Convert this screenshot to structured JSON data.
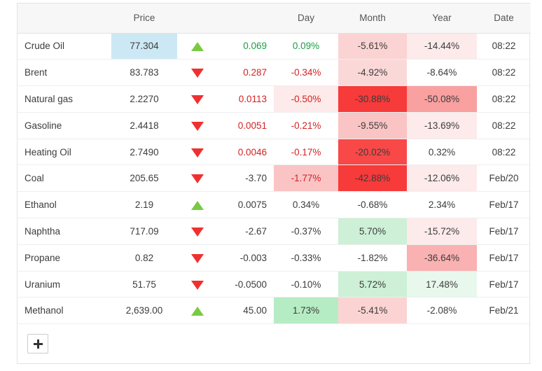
{
  "table": {
    "columns": [
      {
        "key": "name",
        "label": ""
      },
      {
        "key": "price",
        "label": "Price"
      },
      {
        "key": "arrow",
        "label": ""
      },
      {
        "key": "chg",
        "label": ""
      },
      {
        "key": "day",
        "label": "Day"
      },
      {
        "key": "month",
        "label": "Month"
      },
      {
        "key": "year",
        "label": "Year"
      },
      {
        "key": "date",
        "label": "Date"
      }
    ],
    "rows": [
      {
        "name": "Crude Oil",
        "price": "77.304",
        "price_hl": "#cce8f4",
        "dir": "up",
        "change": "0.069",
        "change_dir": "up",
        "day": "0.09%",
        "day_dir": "up",
        "day_bg": "",
        "month": "-5.61%",
        "month_bg": "#fbd3d3",
        "year": "-14.44%",
        "year_bg": "#fdeaea",
        "date": "08:22"
      },
      {
        "name": "Brent",
        "price": "83.783",
        "price_hl": "",
        "dir": "down",
        "change": "0.287",
        "change_dir": "down",
        "day": "-0.34%",
        "day_dir": "down",
        "day_bg": "",
        "month": "-4.92%",
        "month_bg": "#fbd8d8",
        "year": "-8.64%",
        "year_bg": "",
        "date": "08:22"
      },
      {
        "name": "Natural gas",
        "price": "2.2270",
        "price_hl": "",
        "dir": "down",
        "change": "0.0113",
        "change_dir": "down",
        "day": "-0.50%",
        "day_dir": "down",
        "day_bg": "#fdeaea",
        "month": "-30.88%",
        "month_bg": "#f73a3a",
        "year": "-50.08%",
        "year_bg": "#f9a0a0",
        "date": "08:22"
      },
      {
        "name": "Gasoline",
        "price": "2.4418",
        "price_hl": "",
        "dir": "down",
        "change": "0.0051",
        "change_dir": "down",
        "day": "-0.21%",
        "day_dir": "down",
        "day_bg": "",
        "month": "-9.55%",
        "month_bg": "#fac4c4",
        "year": "-13.69%",
        "year_bg": "#fdeaea",
        "date": "08:22"
      },
      {
        "name": "Heating Oil",
        "price": "2.7490",
        "price_hl": "",
        "dir": "down",
        "change": "0.0046",
        "change_dir": "down",
        "day": "-0.17%",
        "day_dir": "down",
        "day_bg": "",
        "month": "-20.02%",
        "month_bg": "#f94848",
        "year": "0.32%",
        "year_bg": "",
        "date": "08:22"
      },
      {
        "name": "Coal",
        "price": "205.65",
        "price_hl": "",
        "dir": "down",
        "change": "-3.70",
        "change_dir": "neutral",
        "day": "-1.77%",
        "day_dir": "down",
        "day_bg": "#fac4c4",
        "month": "-42.88%",
        "month_bg": "#f73a3a",
        "year": "-12.06%",
        "year_bg": "#fdeaea",
        "date": "Feb/20"
      },
      {
        "name": "Ethanol",
        "price": "2.19",
        "price_hl": "",
        "dir": "up",
        "change": "0.0075",
        "change_dir": "neutral",
        "day": "0.34%",
        "day_dir": "neutral",
        "day_bg": "",
        "month": "-0.68%",
        "month_bg": "",
        "year": "2.34%",
        "year_bg": "",
        "date": "Feb/17"
      },
      {
        "name": "Naphtha",
        "price": "717.09",
        "price_hl": "",
        "dir": "down",
        "change": "-2.67",
        "change_dir": "neutral",
        "day": "-0.37%",
        "day_dir": "neutral",
        "day_bg": "",
        "month": "5.70%",
        "month_bg": "#cdf0d7",
        "year": "-15.72%",
        "year_bg": "#fdeaea",
        "date": "Feb/17"
      },
      {
        "name": "Propane",
        "price": "0.82",
        "price_hl": "",
        "dir": "down",
        "change": "-0.003",
        "change_dir": "neutral",
        "day": "-0.33%",
        "day_dir": "neutral",
        "day_bg": "",
        "month": "-1.82%",
        "month_bg": "",
        "year": "-36.64%",
        "year_bg": "#f9b1b1",
        "date": "Feb/17"
      },
      {
        "name": "Uranium",
        "price": "51.75",
        "price_hl": "",
        "dir": "down",
        "change": "-0.0500",
        "change_dir": "neutral",
        "day": "-0.10%",
        "day_dir": "neutral",
        "day_bg": "",
        "month": "5.72%",
        "month_bg": "#cdf0d7",
        "year": "17.48%",
        "year_bg": "#e8f8ed",
        "date": "Feb/17"
      },
      {
        "name": "Methanol",
        "price": "2,639.00",
        "price_hl": "",
        "dir": "up",
        "change": "45.00",
        "change_dir": "neutral",
        "day": "1.73%",
        "day_dir": "neutral",
        "day_bg": "#b6ecc4",
        "month": "-5.41%",
        "month_bg": "#fbd3d3",
        "year": "-2.08%",
        "year_bg": "",
        "date": "Feb/21"
      }
    ],
    "add_row": {
      "button_label": "+",
      "icon": "plus-icon"
    }
  },
  "colors": {
    "up_arrow": "#7ac943",
    "down_arrow": "#f03030",
    "up_text": "#1a9e45",
    "down_text": "#d32222",
    "price_highlight": "#cce8f4",
    "header_bg": "#f7f7f7",
    "border": "#e3e3e3"
  }
}
